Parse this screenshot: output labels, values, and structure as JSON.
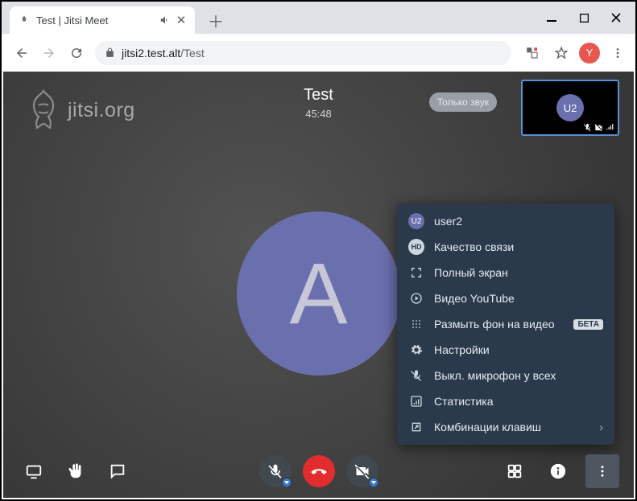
{
  "browser": {
    "tab_title": "Test | Jitsi Meet",
    "url_host": "jitsi2.test.alt",
    "url_path": "/Test",
    "profile_initial": "Y"
  },
  "app": {
    "watermark_text": "jitsi.org",
    "room_title": "Test",
    "timer": "45:48",
    "audio_only_label": "Только звук",
    "main_avatar_initial": "A",
    "thumbnail_initials": "U2"
  },
  "menu": {
    "items": [
      {
        "label": "user2",
        "icon": "avatar",
        "avatar_text": "U2"
      },
      {
        "label": "Качество связи",
        "icon": "hd",
        "hd_text": "HD"
      },
      {
        "label": "Полный экран",
        "icon": "fullscreen"
      },
      {
        "label": "Видео YouTube",
        "icon": "play-circle"
      },
      {
        "label": "Размыть фон на видео",
        "icon": "blur",
        "badge": "БЕТА"
      },
      {
        "label": "Настройки",
        "icon": "gear"
      },
      {
        "label": "Выкл. микрофон у всех",
        "icon": "mic-off"
      },
      {
        "label": "Статистика",
        "icon": "stats"
      },
      {
        "label": "Комбинации клавиш",
        "icon": "open-new",
        "chevron": true
      }
    ]
  }
}
